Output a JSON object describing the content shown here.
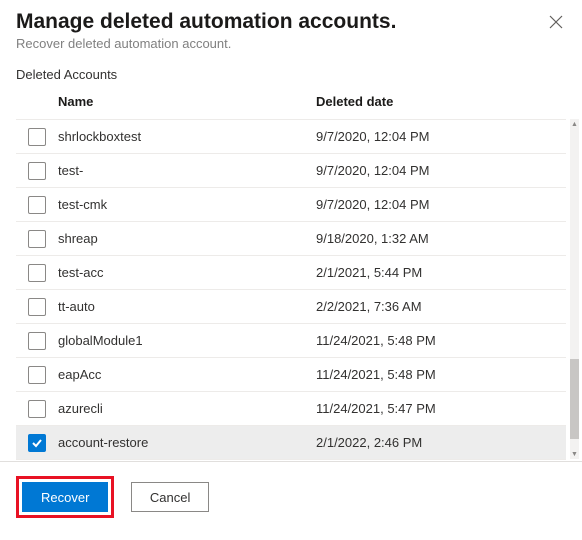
{
  "header": {
    "title": "Manage deleted automation accounts.",
    "subtitle": "Recover deleted automation account."
  },
  "section_label": "Deleted Accounts",
  "columns": {
    "name": "Name",
    "deleted_date": "Deleted date"
  },
  "rows": [
    {
      "name": "shrlockboxtest",
      "date": "9/7/2020, 12:04 PM",
      "checked": false
    },
    {
      "name": "test-",
      "date": "9/7/2020, 12:04 PM",
      "checked": false
    },
    {
      "name": "test-cmk",
      "date": "9/7/2020, 12:04 PM",
      "checked": false
    },
    {
      "name": "shreap",
      "date": "9/18/2020, 1:32 AM",
      "checked": false
    },
    {
      "name": "test-acc",
      "date": "2/1/2021, 5:44 PM",
      "checked": false
    },
    {
      "name": "tt-auto",
      "date": "2/2/2021, 7:36 AM",
      "checked": false
    },
    {
      "name": "globalModule1",
      "date": "11/24/2021, 5:48 PM",
      "checked": false
    },
    {
      "name": "eapAcc",
      "date": "11/24/2021, 5:48 PM",
      "checked": false
    },
    {
      "name": "azurecli",
      "date": "11/24/2021, 5:47 PM",
      "checked": false
    },
    {
      "name": "account-restore",
      "date": "2/1/2022, 2:46 PM",
      "checked": true
    }
  ],
  "buttons": {
    "recover": "Recover",
    "cancel": "Cancel"
  },
  "colors": {
    "primary": "#0078d4",
    "highlight": "#e81123"
  }
}
